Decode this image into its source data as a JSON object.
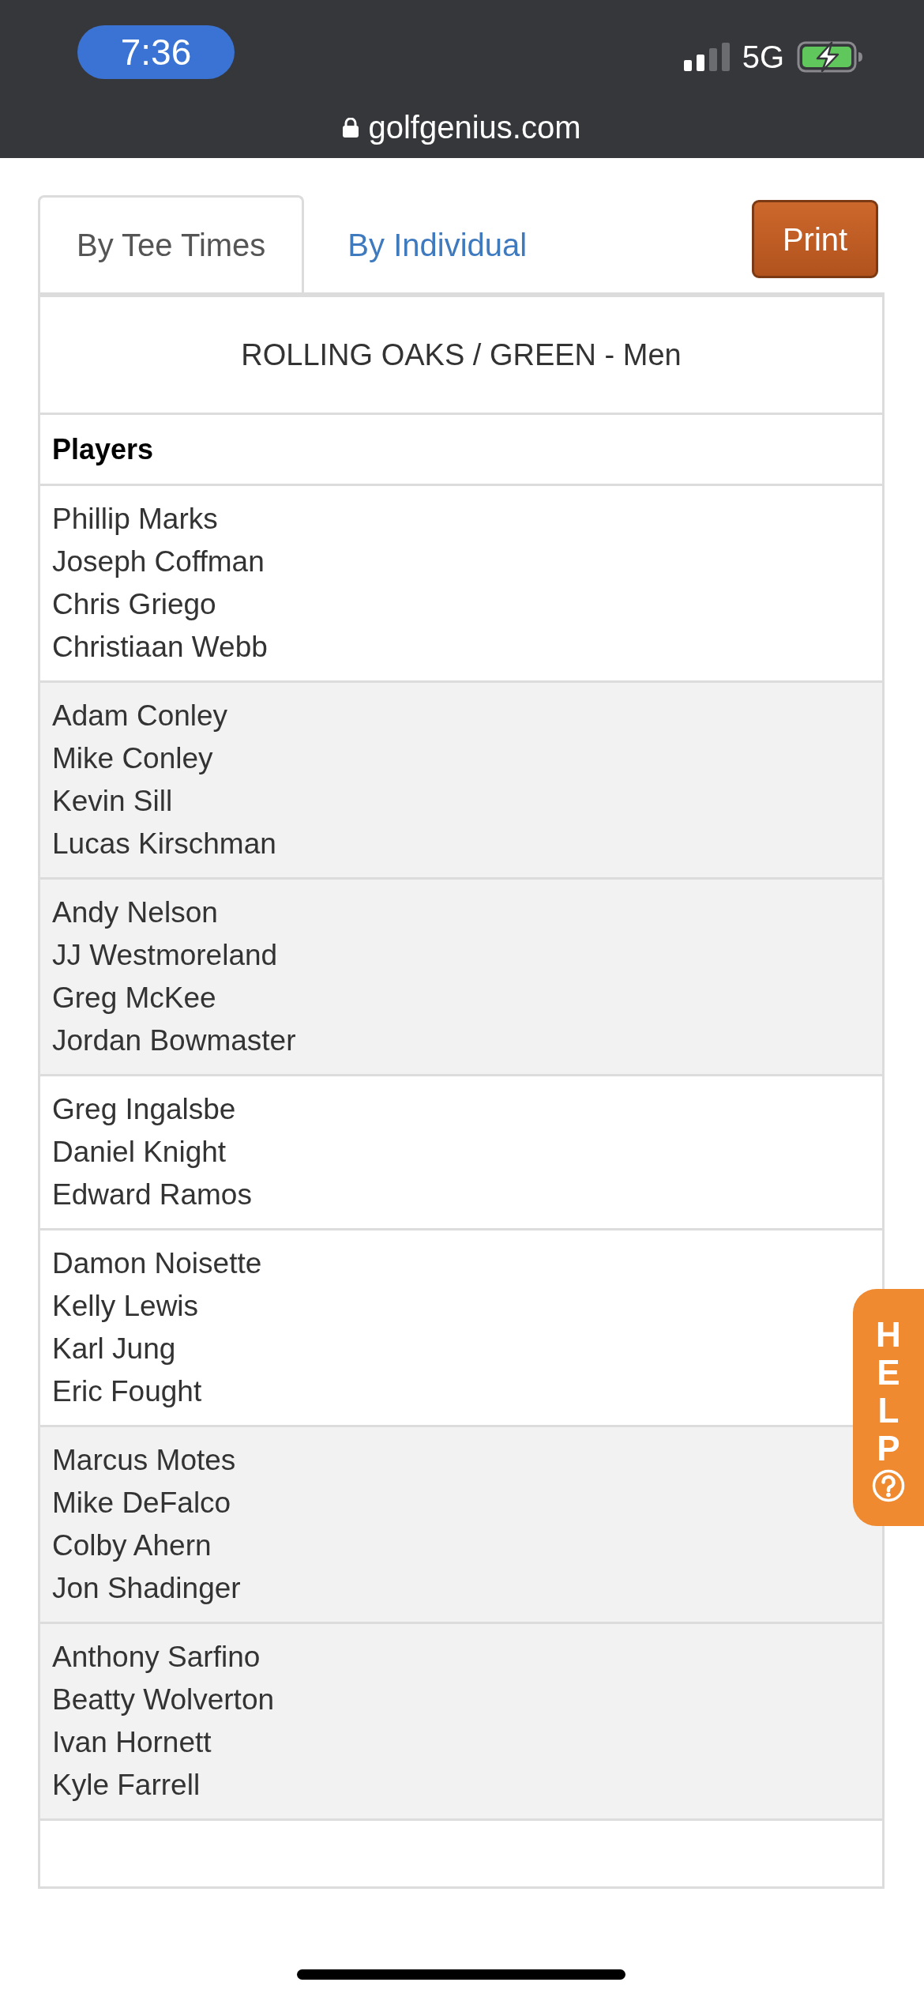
{
  "status_bar": {
    "time": "7:36",
    "network": "5G",
    "battery_charging": true
  },
  "browser": {
    "url": "golfgenius.com",
    "secure": true
  },
  "tabs": [
    {
      "label": "By Tee Times",
      "selected": true
    },
    {
      "label": "By Individual",
      "selected": false
    }
  ],
  "print_button": {
    "label": "Print"
  },
  "table": {
    "title": "ROLLING OAKS / GREEN - Men",
    "header": "Players",
    "groups": [
      {
        "shaded": false,
        "players": [
          "Phillip Marks",
          "Joseph Coffman",
          "Chris Griego",
          "Christiaan Webb"
        ]
      },
      {
        "shaded": true,
        "players": [
          "Adam Conley",
          "Mike Conley",
          "Kevin Sill",
          "Lucas Kirschman"
        ]
      },
      {
        "shaded": true,
        "players": [
          "Andy Nelson",
          "JJ Westmoreland",
          "Greg McKee",
          "Jordan Bowmaster"
        ]
      },
      {
        "shaded": false,
        "players": [
          "Greg Ingalsbe",
          "Daniel Knight",
          "Edward Ramos"
        ]
      },
      {
        "shaded": false,
        "players": [
          "Damon Noisette",
          "Kelly Lewis",
          "Karl Jung",
          "Eric Fought"
        ]
      },
      {
        "shaded": true,
        "players": [
          "Marcus Motes",
          "Mike DeFalco",
          "Colby Ahern",
          "Jon Shadinger"
        ]
      },
      {
        "shaded": true,
        "players": [
          "Anthony Sarfino",
          "Beatty Wolverton",
          "Ivan Hornett",
          "Kyle Farrell"
        ]
      }
    ]
  },
  "help_tab": {
    "label": "HELP"
  }
}
